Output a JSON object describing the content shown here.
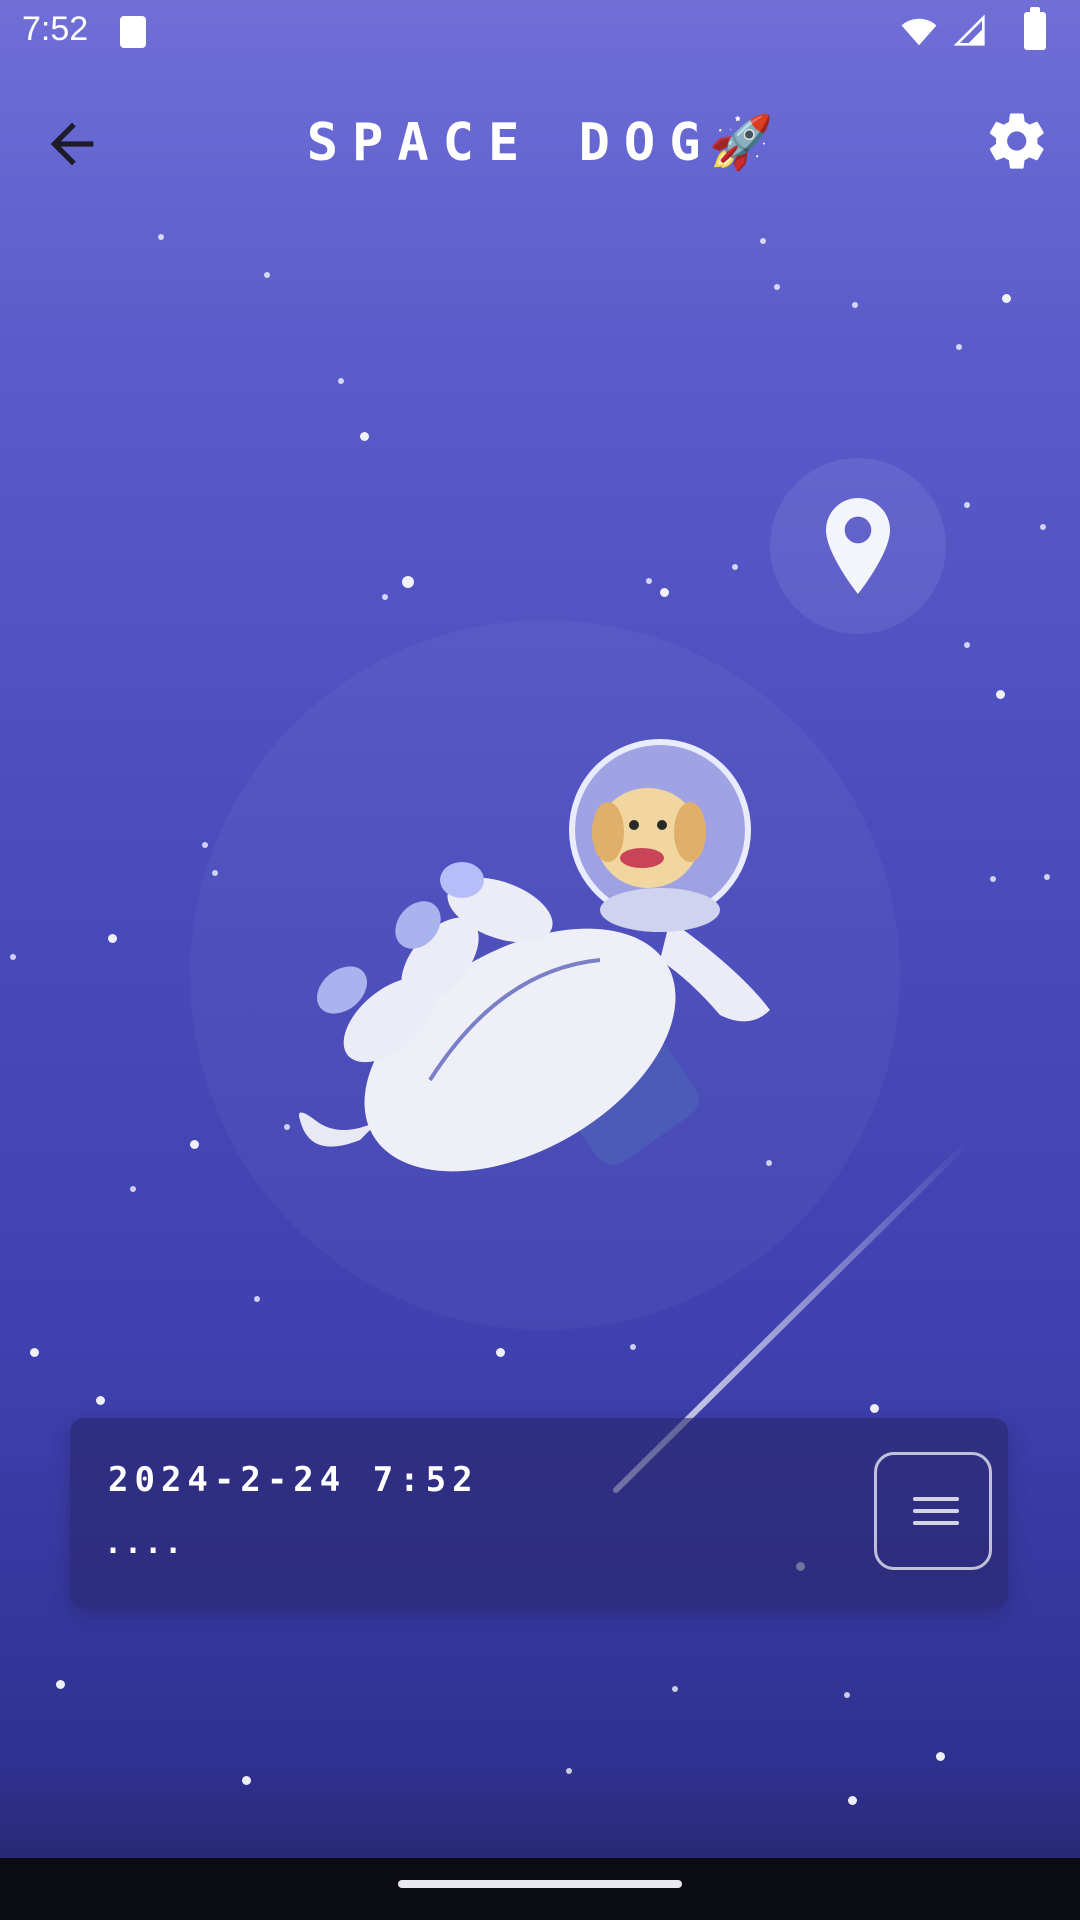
{
  "status_bar": {
    "time": "7:52",
    "icons": [
      "sd-card-icon",
      "wifi-icon",
      "cell-signal-icon",
      "battery-icon"
    ]
  },
  "app_bar": {
    "title": "SPACE DOG",
    "title_emoji": "🚀",
    "back_icon": "arrow-left-icon",
    "settings_icon": "gear-icon"
  },
  "main": {
    "location_icon": "map-pin-icon",
    "hero_image": "astronaut-dog-illustration"
  },
  "info_card": {
    "datetime": "2024-2-24 7:52",
    "subtitle": "....",
    "menu_icon": "hamburger-menu-icon"
  },
  "colors": {
    "background_top": "#6f6fd6",
    "background_bottom": "#232565",
    "card_background": "#28266e",
    "text": "#ffffff"
  }
}
